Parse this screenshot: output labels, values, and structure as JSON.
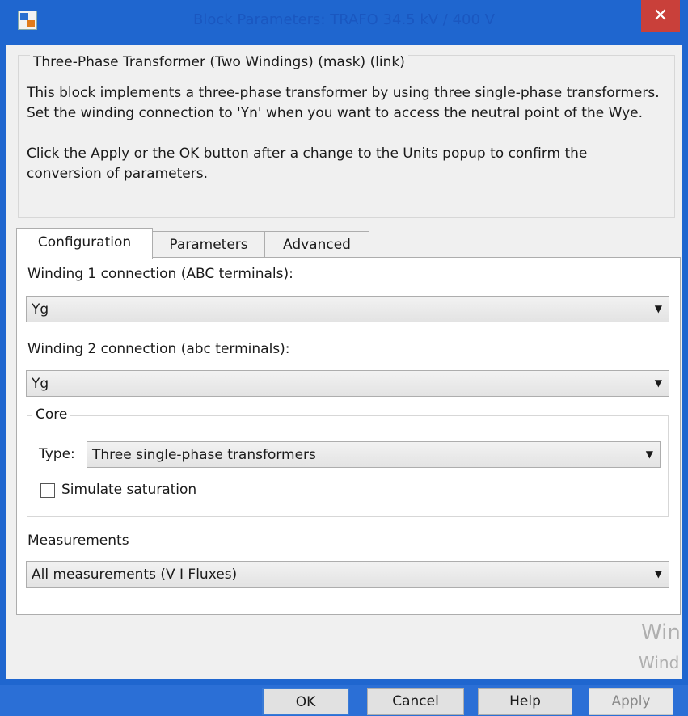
{
  "window": {
    "title": "Block Parameters: TRAFO 34.5 kV / 400 V",
    "close_glyph": "✕"
  },
  "description": {
    "group_label": "Three-Phase Transformer (Two Windings) (mask) (link)",
    "paragraph1": "This block implements a three-phase transformer by using three single-phase transformers. Set the winding connection to 'Yn'  when you want to access the neutral point of the Wye.",
    "paragraph2": "Click the Apply or the OK button after a change to the Units popup to confirm the conversion of parameters."
  },
  "tabs": [
    {
      "label": "Configuration",
      "active": true
    },
    {
      "label": "Parameters",
      "active": false
    },
    {
      "label": "Advanced",
      "active": false
    }
  ],
  "config": {
    "winding1_label": "Winding 1 connection (ABC terminals):",
    "winding1_value": "Yg",
    "winding2_label": "Winding 2 connection (abc terminals):",
    "winding2_value": "Yg",
    "core_label": "Core",
    "type_label": "Type:",
    "type_value": "Three single-phase transformers",
    "saturation_label": "Simulate saturation",
    "saturation_checked": false,
    "measurements_label": "Measurements",
    "measurements_value": "All measurements (V I Fluxes)",
    "dropdown_arrow": "▼"
  },
  "buttons": {
    "ok": "OK",
    "cancel": "Cancel",
    "help": "Help",
    "apply": "Apply"
  },
  "watermark": {
    "line1": "Win",
    "line2": "Wind"
  },
  "colors": {
    "titlebar": "#1f66cf",
    "close": "#c9403a",
    "dialog_bg": "#f0f0f0"
  }
}
